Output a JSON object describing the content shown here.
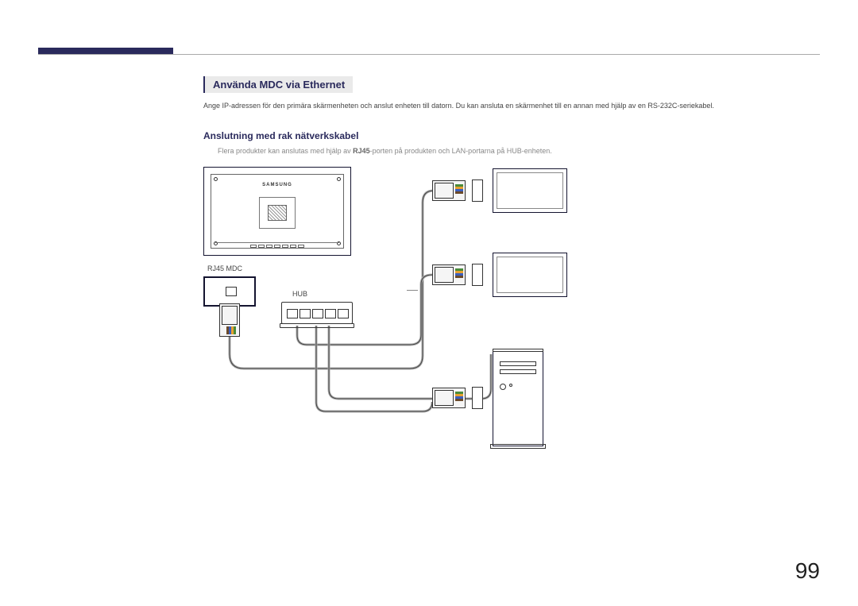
{
  "section_title": "Använda MDC via Ethernet",
  "intro_text": "Ange IP-adressen för den primära skärmenheten och anslut enheten till datorn. Du kan ansluta en skärmenhet till en annan med hjälp av en RS-232C-seriekabel.",
  "sub_title": "Anslutning med rak nätverkskabel",
  "note_prefix": "Flera produkter kan anslutas med hjälp av ",
  "note_bold": "RJ45",
  "note_suffix": "-porten på produkten och LAN-portarna på HUB-enheten.",
  "labels": {
    "rj45": "RJ45 MDC",
    "hub": "HUB",
    "brand": "SAMSUNG"
  },
  "page_number": "99"
}
